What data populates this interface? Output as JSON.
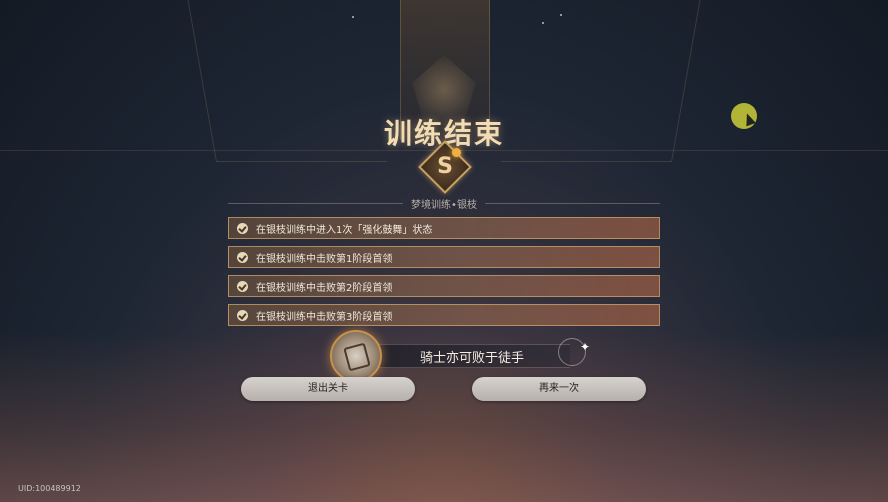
{
  "title": "训练结束",
  "grade": "S",
  "subtitle": "梦境训练•银枝",
  "objectives": [
    {
      "text": "在银枝训练中进入1次「强化鼓舞」状态",
      "completed": true
    },
    {
      "text": "在银枝训练中击败第1阶段首领",
      "completed": true
    },
    {
      "text": "在银枝训练中击败第2阶段首领",
      "completed": true
    },
    {
      "text": "在银枝训练中击败第3阶段首领",
      "completed": true
    }
  ],
  "reward": {
    "name": "骑士亦可败于徒手"
  },
  "buttons": {
    "exit": "退出关卡",
    "retry": "再来一次"
  },
  "uid": "UID:100489912",
  "colors": {
    "accent": "#f2dcb4",
    "button": "#c8c4c0",
    "cursor": "#e6e63c"
  }
}
